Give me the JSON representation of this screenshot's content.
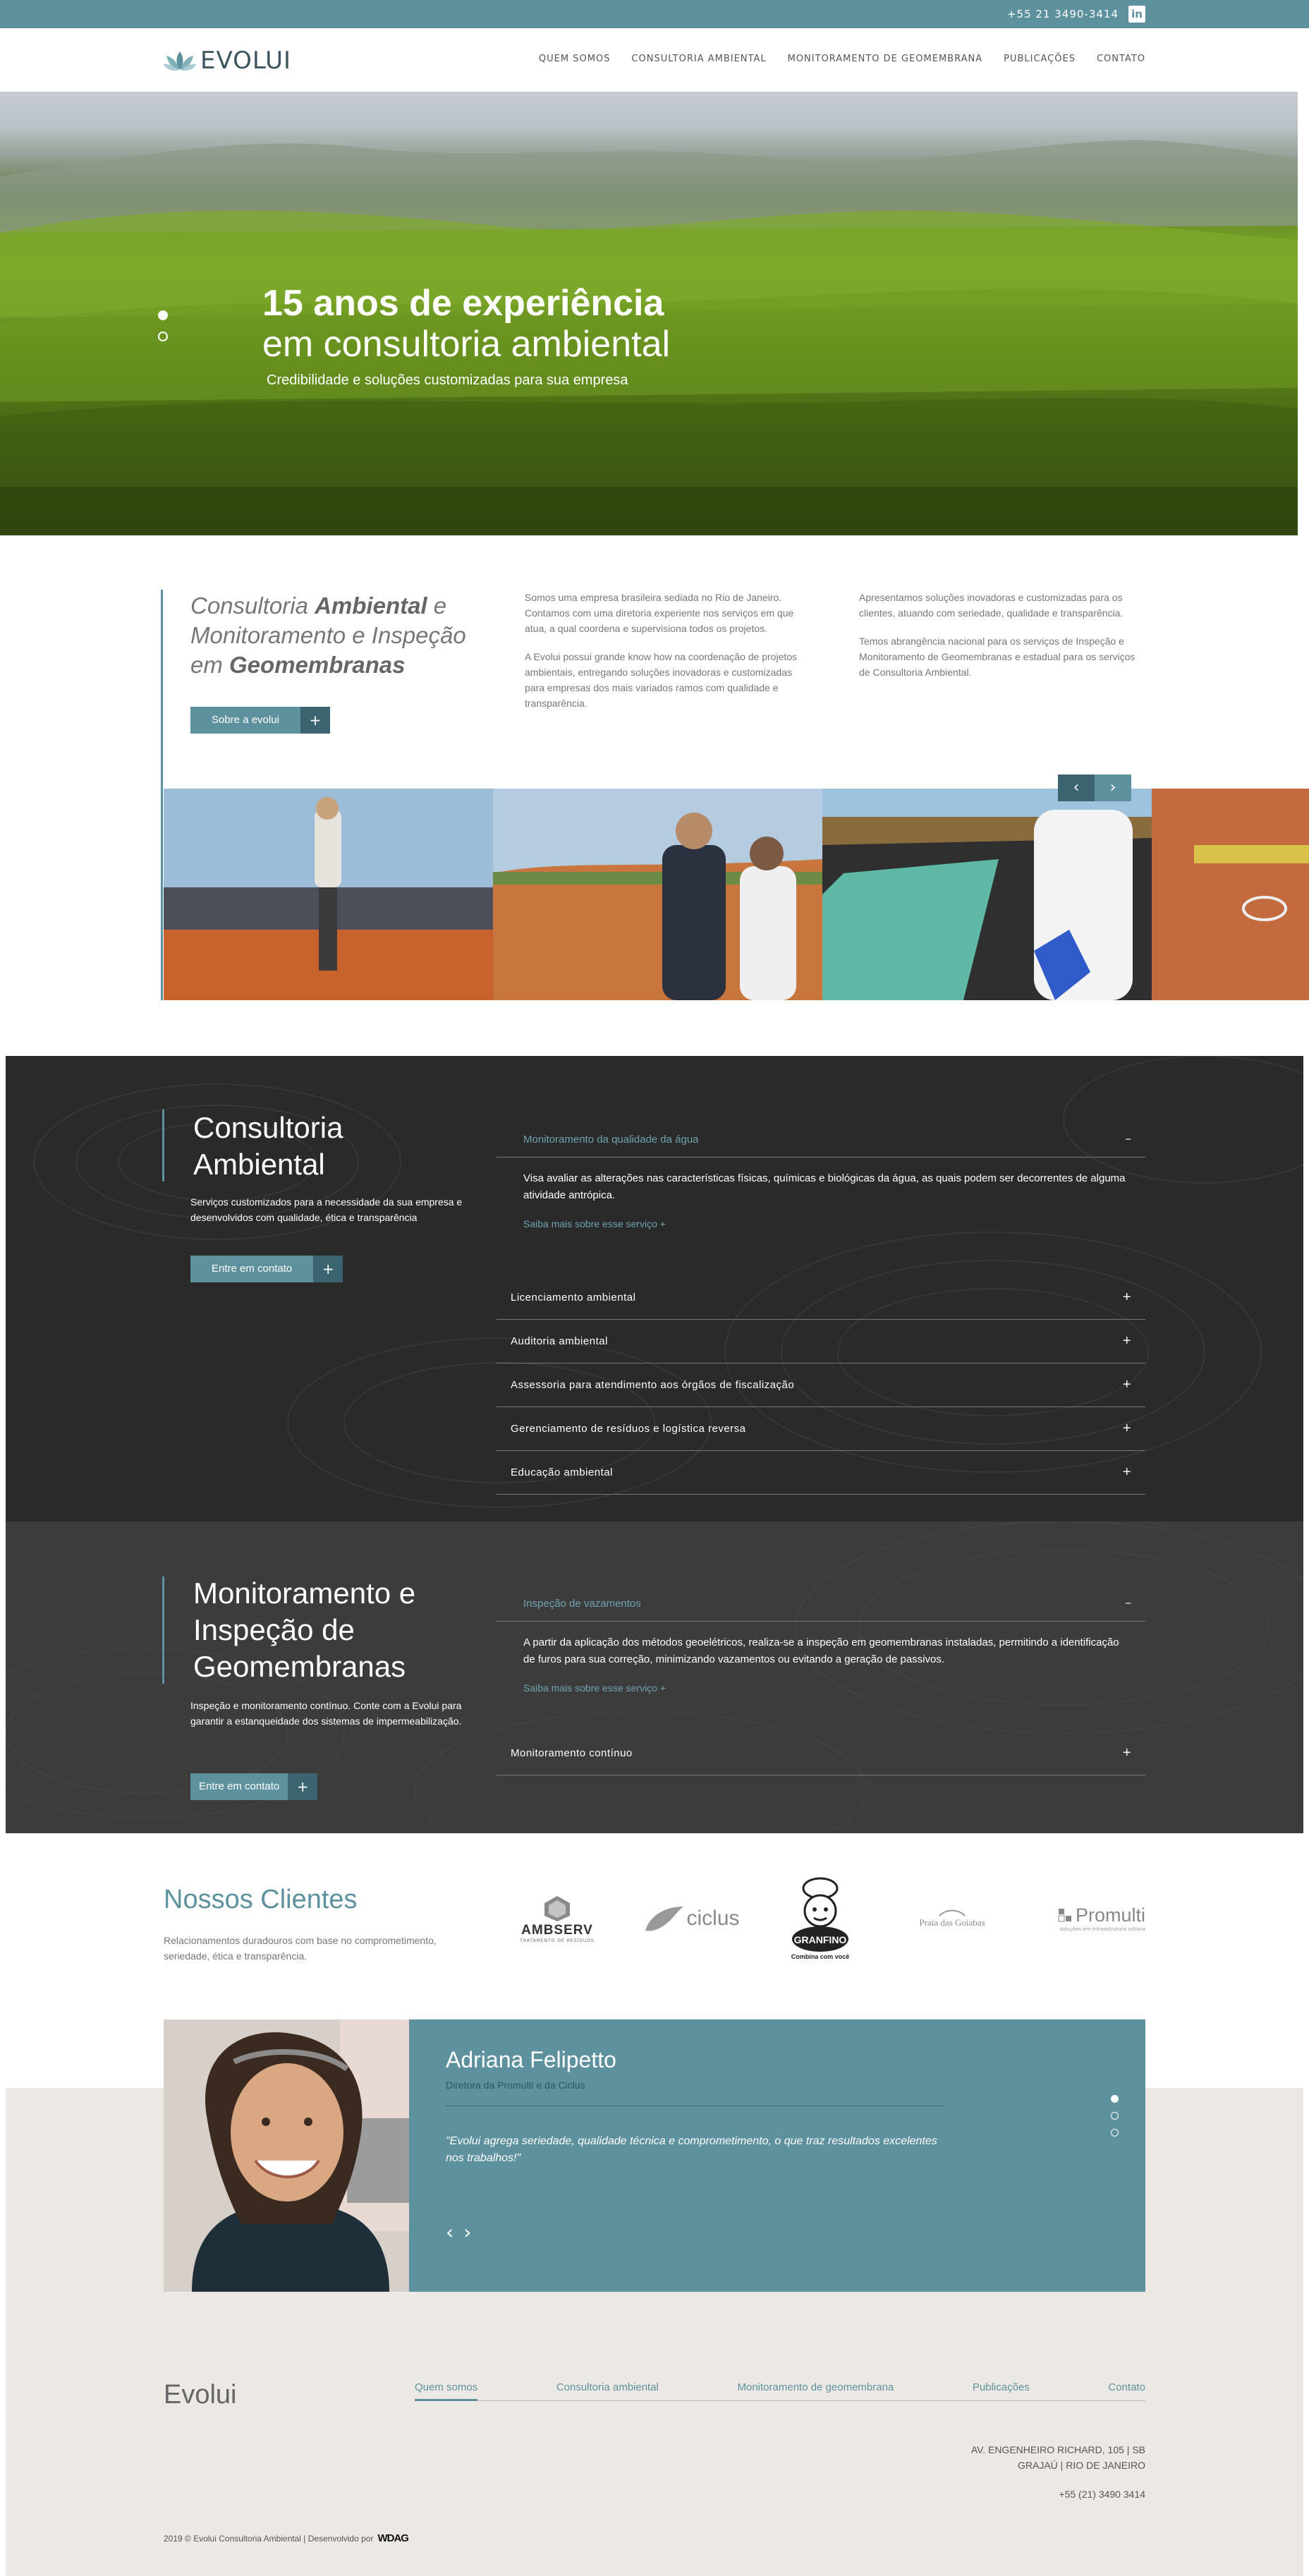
{
  "topbar": {
    "phone": "+55 21 3490-3414",
    "linkedin_icon": "linkedin-icon",
    "linkedin_label": "in"
  },
  "header": {
    "logo_text": "EVOLUI",
    "nav": [
      "QUEM SOMOS",
      "CONSULTORIA AMBIENTAL",
      "MONITORAMENTO DE GEOMEMBRANA",
      "PUBLICAÇÕES",
      "CONTATO"
    ]
  },
  "hero": {
    "title_bold": "15 anos de experiência",
    "title_light": "em consultoria ambiental",
    "subtitle": "Credibilidade e soluções customizadas para sua empresa"
  },
  "about": {
    "title_1": "Consultoria ",
    "title_2": "Ambiental",
    "title_3": " e Monitoramento e Inspeção em ",
    "title_4": "Geomembranas",
    "button": "Sobre a evolui",
    "col1_p1": "Somos uma empresa brasileira sediada no Rio de Janeiro. Contamos com uma diretoria experiente nos serviços em que atua, a qual coordena e supervisiona todos os projetos.",
    "col1_p2": "A Evolui possui grande know how na coordenação de projetos ambientais, entregando soluções inovadoras e customizadas para empresas dos mais variados ramos com qualidade e transparência.",
    "col2_p1": "Apresentamos soluções inovadoras e customizadas para os clientes, atuando com seriedade, qualidade e transparência.",
    "col2_p2": "Temos abrangência nacional para os serviços de Inspeção e Monitoramento de Geomembranas e estadual para os serviços de Consultoria Ambiental.",
    "prev": "‹",
    "next": "›"
  },
  "consultoria": {
    "title": "Consultoria Ambiental",
    "subtitle": "Serviços customizados para a necessidade da sua empresa e desenvolvidos com qualidade, ética e transparência",
    "button": "Entre em contato",
    "open_item": {
      "title": "Monitoramento da qualidade da água",
      "body": "Visa avaliar as alterações nas características físicas, químicas e biológicas da água, as quais podem ser decorrentes de alguma atividade antrópica.",
      "link": "Saiba mais sobre esse serviço +"
    },
    "items": [
      "Licenciamento ambiental",
      "Auditoria ambiental",
      "Assessoria para atendimento aos órgãos de fiscalização",
      "Gerenciamento de resíduos e logística reversa",
      "Educação ambiental"
    ]
  },
  "monitoramento": {
    "title": "Monitoramento e Inspeção de Geomembranas",
    "subtitle": "Inspeção e monitoramento contínuo. Conte com a Evolui para garantir a estanqueidade dos sistemas de impermeabilização.",
    "button": "Entre em contato",
    "open_item": {
      "title": "Inspeção de vazamentos",
      "body": "A partir da aplicação dos métodos geoelétricos, realiza-se a inspeção em geomembranas instaladas, permitindo a identificação de furos para sua correção, minimizando vazamentos ou evitando a geração de passivos.",
      "link": "Saiba mais sobre esse serviço +"
    },
    "items": [
      "Monitoramento contínuo"
    ]
  },
  "clients": {
    "title": "Nossos Clientes",
    "subtitle": "Relacionamentos duradouros com base no comprometimento, seriedade, ética e transparência.",
    "logos": [
      "AMBSERV",
      "TRATAMENTO DE RESÍDUOS",
      "ciclus",
      "GRANFINO",
      "Combina com você",
      "Praia das Goiabas",
      "Promulti",
      "soluções em infraestrutura urbana"
    ]
  },
  "testimonial": {
    "name": "Adriana Felipetto",
    "role": "Diretora da Promulti e da Ciclus",
    "quote": "\"Evolui agrega seriedade, qualidade técnica e comprometimento, o que traz resultados excelentes nos trabalhos!\""
  },
  "footer": {
    "logo": "Evolui",
    "nav": [
      "Quem somos",
      "Consultoria ambiental",
      "Monitoramento de geomembrana",
      "Publicações",
      "Contato"
    ],
    "address_1": "AV. ENGENHEIRO RICHARD, 105 | SB",
    "address_2": "GRAJAÚ | RIO DE JANEIRO",
    "phone": "+55 (21) 3490 3414",
    "copyright": "2019 © Evolui Consultoria Ambiental | Desenvolvido por",
    "dev": "WDAG"
  }
}
